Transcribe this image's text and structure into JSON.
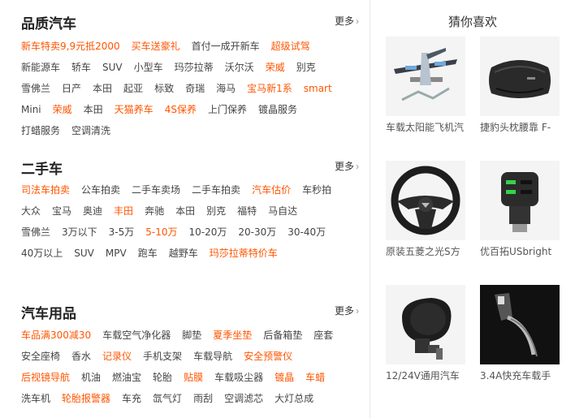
{
  "sections": [
    {
      "title": "品质汽车",
      "more": "更多",
      "rows": [
        [
          {
            "t": "新车特卖9,9元抵2000",
            "hot": true
          },
          {
            "t": "买车送豪礼",
            "hot": true
          },
          {
            "t": "首付一成开新车",
            "hot": false
          },
          {
            "t": "超级试驾",
            "hot": true
          }
        ],
        [
          {
            "t": "新能源车",
            "hot": false
          },
          {
            "t": "轿车",
            "hot": false
          },
          {
            "t": "SUV",
            "hot": false
          },
          {
            "t": "小型车",
            "hot": false
          },
          {
            "t": "玛莎拉蒂",
            "hot": false
          },
          {
            "t": "沃尔沃",
            "hot": false
          },
          {
            "t": "荣威",
            "hot": true
          },
          {
            "t": "别克",
            "hot": false
          }
        ],
        [
          {
            "t": "雪佛兰",
            "hot": false
          },
          {
            "t": "日产",
            "hot": false
          },
          {
            "t": "本田",
            "hot": false
          },
          {
            "t": "起亚",
            "hot": false
          },
          {
            "t": "标致",
            "hot": false
          },
          {
            "t": "奇瑞",
            "hot": false
          },
          {
            "t": "海马",
            "hot": false
          },
          {
            "t": "宝马新1系",
            "hot": true
          },
          {
            "t": "smart",
            "hot": true
          }
        ],
        [
          {
            "t": "Mini",
            "hot": false
          },
          {
            "t": "荣威",
            "hot": true
          },
          {
            "t": "本田",
            "hot": false
          },
          {
            "t": "天猫养车",
            "hot": true
          },
          {
            "t": "4S保养",
            "hot": true
          },
          {
            "t": "上门保养",
            "hot": false
          },
          {
            "t": "镀晶服务",
            "hot": false
          }
        ],
        [
          {
            "t": "打蜡服务",
            "hot": false
          },
          {
            "t": "空调清洗",
            "hot": false
          }
        ]
      ]
    },
    {
      "title": "二手车",
      "more": "更多",
      "rows": [
        [
          {
            "t": "司法车拍卖",
            "hot": true
          },
          {
            "t": "公车拍卖",
            "hot": false
          },
          {
            "t": "二手车卖场",
            "hot": false
          },
          {
            "t": "二手车拍卖",
            "hot": false
          },
          {
            "t": "汽车估价",
            "hot": true
          },
          {
            "t": "车秒拍",
            "hot": false
          }
        ],
        [
          {
            "t": "大众",
            "hot": false
          },
          {
            "t": "宝马",
            "hot": false
          },
          {
            "t": "奥迪",
            "hot": false
          },
          {
            "t": "丰田",
            "hot": true
          },
          {
            "t": "奔驰",
            "hot": false
          },
          {
            "t": "本田",
            "hot": false
          },
          {
            "t": "别克",
            "hot": false
          },
          {
            "t": "福特",
            "hot": false
          },
          {
            "t": "马自达",
            "hot": false
          }
        ],
        [
          {
            "t": "雪佛兰",
            "hot": false
          },
          {
            "t": "3万以下",
            "hot": false
          },
          {
            "t": "3-5万",
            "hot": false
          },
          {
            "t": "5-10万",
            "hot": true
          },
          {
            "t": "10-20万",
            "hot": false
          },
          {
            "t": "20-30万",
            "hot": false
          },
          {
            "t": "30-40万",
            "hot": false
          }
        ],
        [
          {
            "t": "40万以上",
            "hot": false
          },
          {
            "t": "SUV",
            "hot": false
          },
          {
            "t": "MPV",
            "hot": false
          },
          {
            "t": "跑车",
            "hot": false
          },
          {
            "t": "越野车",
            "hot": false
          },
          {
            "t": "玛莎拉蒂特价车",
            "hot": true
          }
        ]
      ]
    },
    {
      "title": "汽车用品",
      "more": "更多",
      "rows": [
        [
          {
            "t": "车品满300减30",
            "hot": true
          },
          {
            "t": "车载空气净化器",
            "hot": false
          },
          {
            "t": "脚垫",
            "hot": false
          },
          {
            "t": "夏季坐垫",
            "hot": true
          },
          {
            "t": "后备箱垫",
            "hot": false
          },
          {
            "t": "座套",
            "hot": false
          }
        ],
        [
          {
            "t": "安全座椅",
            "hot": false
          },
          {
            "t": "香水",
            "hot": false
          },
          {
            "t": "记录仪",
            "hot": true
          },
          {
            "t": "手机支架",
            "hot": false
          },
          {
            "t": "车载导航",
            "hot": false
          },
          {
            "t": "安全预警仪",
            "hot": true
          }
        ],
        [
          {
            "t": "后视镜导航",
            "hot": true
          },
          {
            "t": "机油",
            "hot": false
          },
          {
            "t": "燃油宝",
            "hot": false
          },
          {
            "t": "轮胎",
            "hot": false
          },
          {
            "t": "贴膜",
            "hot": true
          },
          {
            "t": "车载吸尘器",
            "hot": false
          },
          {
            "t": "镀晶",
            "hot": true
          },
          {
            "t": "车蜡",
            "hot": true
          }
        ],
        [
          {
            "t": "洗车机",
            "hot": false
          },
          {
            "t": "轮胎报警器",
            "hot": true
          },
          {
            "t": "车充",
            "hot": false
          },
          {
            "t": "氙气灯",
            "hot": false
          },
          {
            "t": "雨刮",
            "hot": false
          },
          {
            "t": "空调滤芯",
            "hot": false
          },
          {
            "t": "大灯总成",
            "hot": false
          }
        ]
      ]
    }
  ],
  "guess": {
    "title": "猜你喜欢",
    "items": [
      {
        "name": "车载太阳能飞机汽",
        "icon": "solar-airplane-ornament-icon"
      },
      {
        "name": "捷豹头枕腰靠 F-",
        "icon": "neck-pillow-icon"
      },
      {
        "name": "原装五菱之光S方",
        "icon": "steering-wheel-icon"
      },
      {
        "name": "优百拓USbright",
        "icon": "usb-car-charger-icon"
      },
      {
        "name": "12/24V通用汽车",
        "icon": "car-horn-icon"
      },
      {
        "name": "3.4A快充车载手",
        "icon": "car-phone-charger-icon"
      }
    ]
  },
  "colors": {
    "hot": "#ff5500",
    "text": "#444444",
    "divider": "#e8e8e8"
  }
}
